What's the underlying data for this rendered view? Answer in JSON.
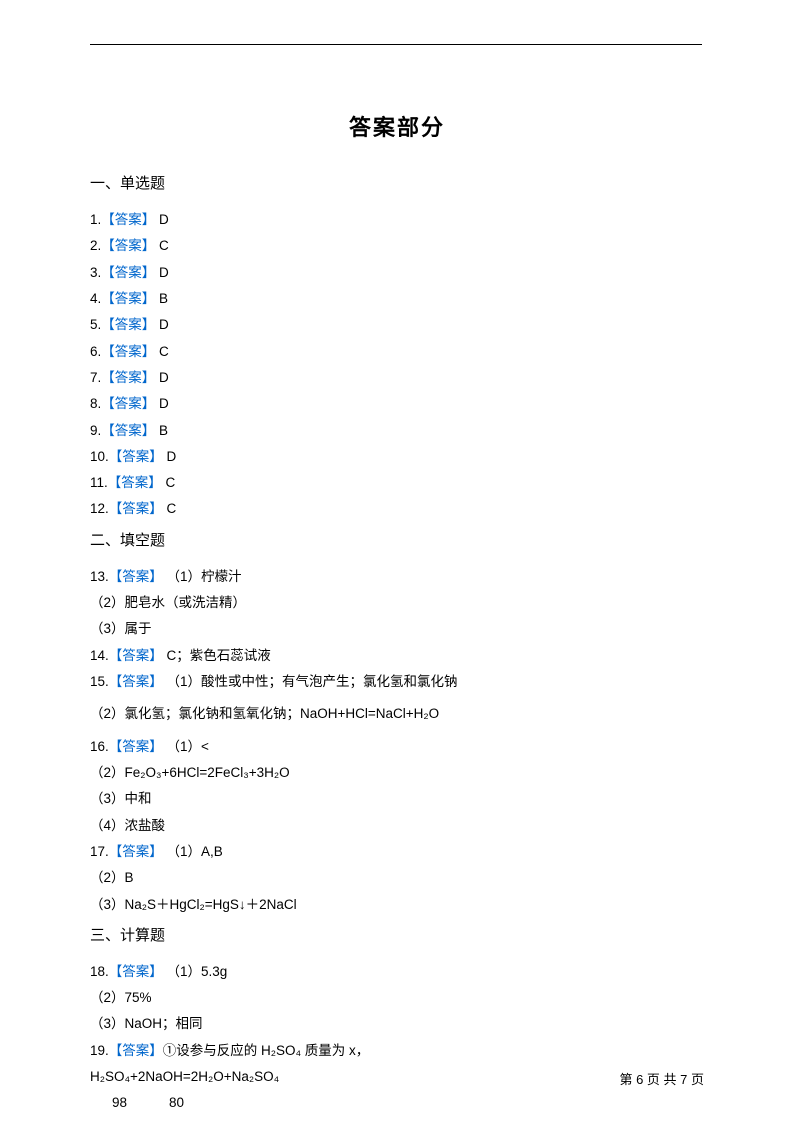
{
  "title": "答案部分",
  "section1_header": "一、单选题",
  "section2_header": "二、填空题",
  "section3_header": "三、计算题",
  "answer_label": "【答案】",
  "mc": {
    "q1": {
      "num": "1.",
      "ans": " D"
    },
    "q2": {
      "num": "2.",
      "ans": " C"
    },
    "q3": {
      "num": "3.",
      "ans": " D"
    },
    "q4": {
      "num": "4.",
      "ans": " B"
    },
    "q5": {
      "num": "5.",
      "ans": " D"
    },
    "q6": {
      "num": "6.",
      "ans": " C"
    },
    "q7": {
      "num": "7.",
      "ans": " D"
    },
    "q8": {
      "num": "8.",
      "ans": " D"
    },
    "q9": {
      "num": "9.",
      "ans": " B"
    },
    "q10": {
      "num": "10.",
      "ans": " D"
    },
    "q11": {
      "num": "11.",
      "ans": " C"
    },
    "q12": {
      "num": "12.",
      "ans": " C"
    }
  },
  "q13": {
    "num": "13.",
    "p1": " （1）柠檬汁",
    "p2": "（2）肥皂水（或洗洁精）",
    "p3": "（3）属于"
  },
  "q14": {
    "num": "14.",
    "ans": " C；紫色石蕊试液"
  },
  "q15": {
    "num": "15.",
    "p1": " （1）酸性或中性；有气泡产生；氯化氢和氯化钠",
    "p2": "（2）氯化氢；氯化钠和氢氧化钠；NaOH+HCl=NaCl+H₂O"
  },
  "q16": {
    "num": "16.",
    "p1": " （1）<",
    "p2": "（2）Fe₂O₃+6HCl=2FeCl₃+3H₂O",
    "p3": "（3）中和",
    "p4": "（4）浓盐酸"
  },
  "q17": {
    "num": "17.",
    "p1": " （1）A,B",
    "p2": "（2）B",
    "p3": "（3）Na₂S＋HgCl₂=HgS↓＋2NaCl"
  },
  "q18": {
    "num": "18.",
    "p1": " （1）5.3g",
    "p2": "（2）75%",
    "p3": "（3）NaOH；相同"
  },
  "q19": {
    "num": "19.",
    "p1": "①设参与反应的 H₂SO₄ 质量为  x，",
    "eq": "H₂SO₄+2NaOH=2H₂O+Na₂SO₄",
    "n1": "98",
    "n2": "80"
  },
  "footer": "第 6 页 共 7 页"
}
